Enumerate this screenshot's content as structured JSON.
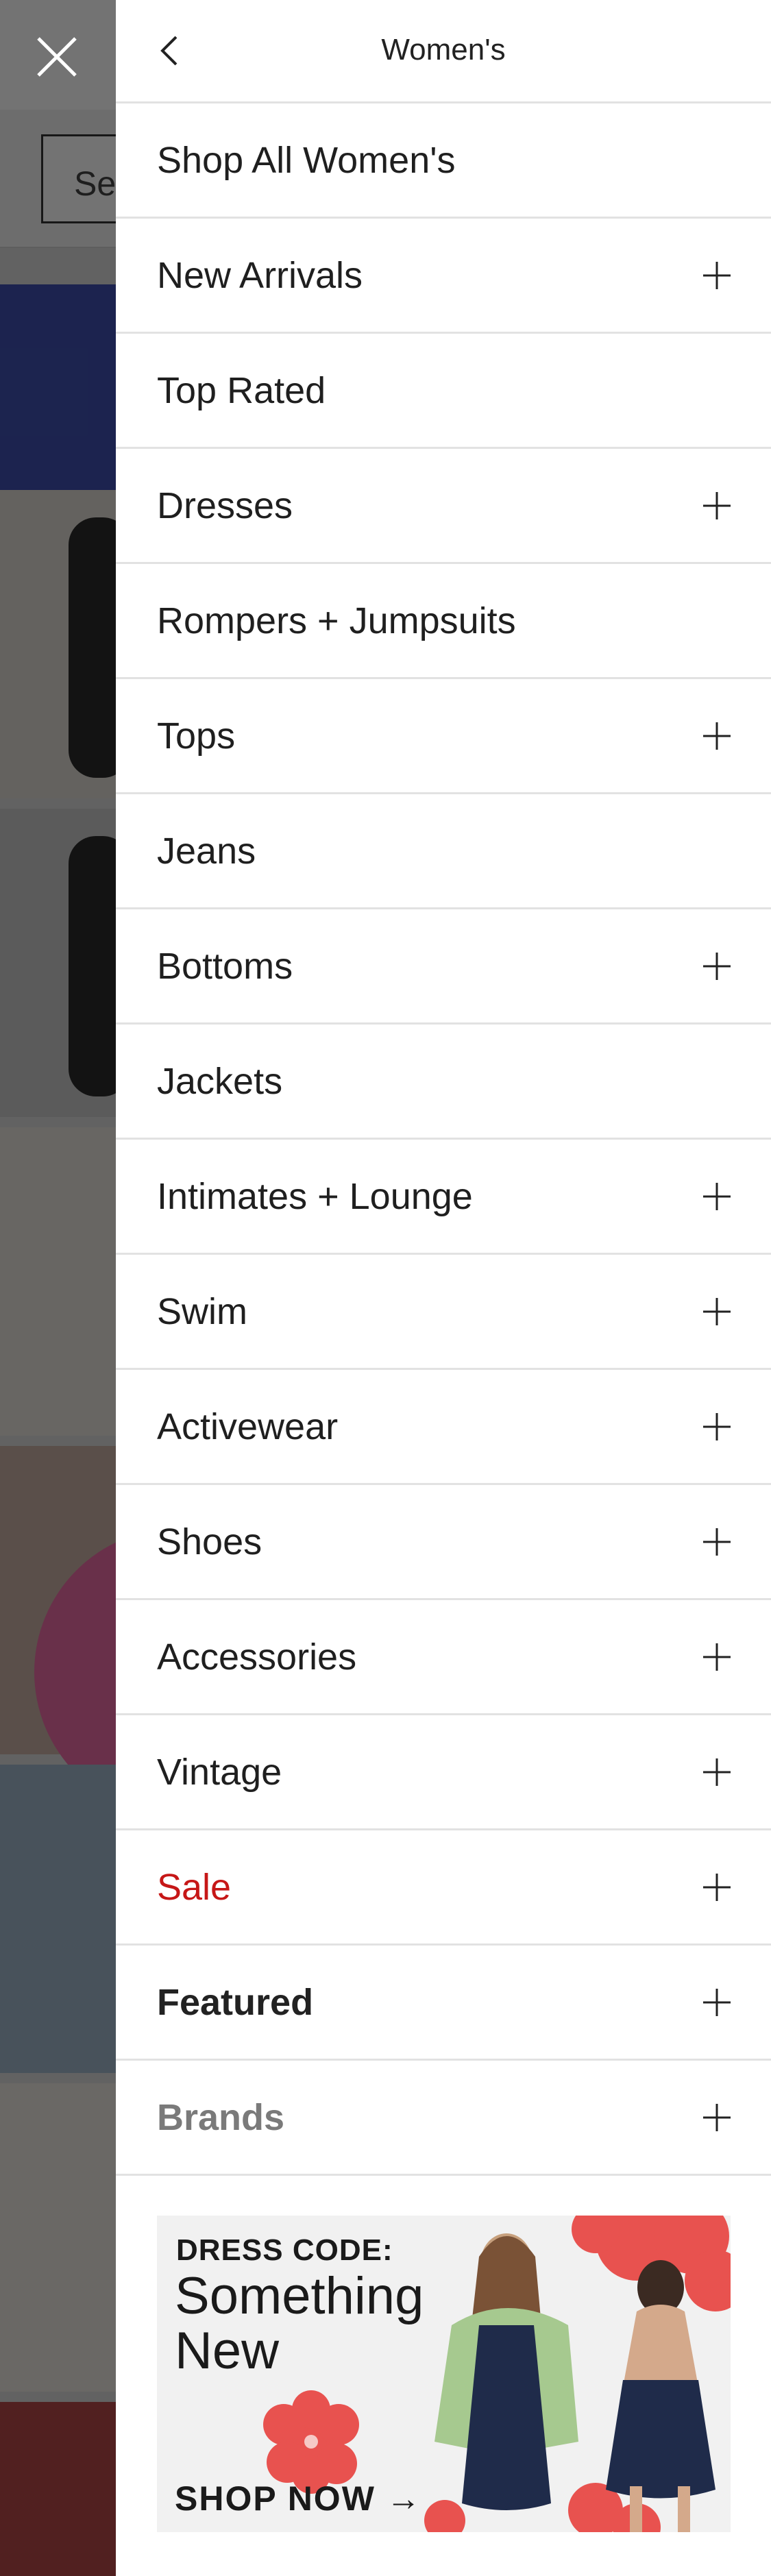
{
  "background_page": {
    "search_placeholder": "Se"
  },
  "drawer": {
    "title": "Women's",
    "items": [
      {
        "label": "Shop All Women's",
        "expandable": false,
        "style": "normal"
      },
      {
        "label": "New Arrivals",
        "expandable": true,
        "style": "normal"
      },
      {
        "label": "Top Rated",
        "expandable": false,
        "style": "normal"
      },
      {
        "label": "Dresses",
        "expandable": true,
        "style": "normal"
      },
      {
        "label": "Rompers + Jumpsuits",
        "expandable": false,
        "style": "normal"
      },
      {
        "label": "Tops",
        "expandable": true,
        "style": "normal"
      },
      {
        "label": "Jeans",
        "expandable": false,
        "style": "normal"
      },
      {
        "label": "Bottoms",
        "expandable": true,
        "style": "normal"
      },
      {
        "label": "Jackets",
        "expandable": false,
        "style": "normal"
      },
      {
        "label": "Intimates + Lounge",
        "expandable": true,
        "style": "normal"
      },
      {
        "label": "Swim",
        "expandable": true,
        "style": "normal"
      },
      {
        "label": "Activewear",
        "expandable": true,
        "style": "normal"
      },
      {
        "label": "Shoes",
        "expandable": true,
        "style": "normal"
      },
      {
        "label": "Accessories",
        "expandable": true,
        "style": "normal"
      },
      {
        "label": "Vintage",
        "expandable": true,
        "style": "normal"
      },
      {
        "label": "Sale",
        "expandable": true,
        "style": "sale"
      },
      {
        "label": "Featured",
        "expandable": true,
        "style": "featured"
      },
      {
        "label": "Brands",
        "expandable": true,
        "style": "brands"
      }
    ],
    "promo": {
      "line1": "DRESS CODE:",
      "line2": "Something New",
      "cta": "SHOP NOW →"
    }
  },
  "icons": {
    "close": "close-icon",
    "back": "chevron-left-icon",
    "expand": "plus-icon"
  },
  "colors": {
    "sale": "#c61717",
    "brands": "#7a7a7a",
    "divider": "#e2e2e2",
    "promo_flower": "#e8524f"
  }
}
